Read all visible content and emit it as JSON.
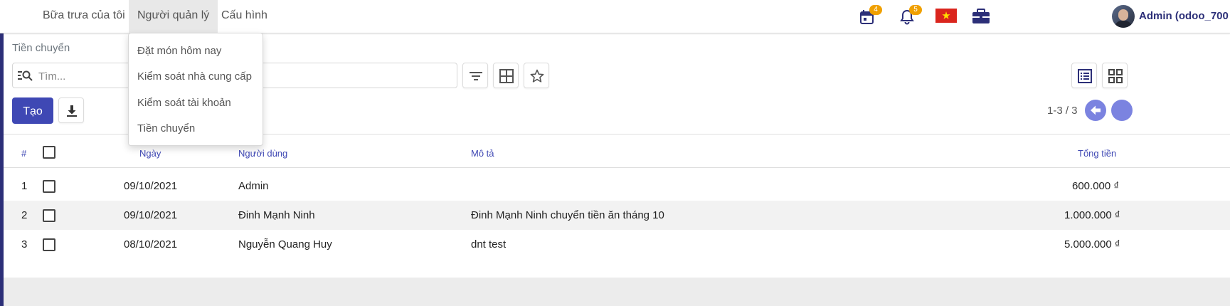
{
  "topbar": {
    "menu": [
      "Bữa trưa của tôi",
      "Người quản lý",
      "Cấu hình"
    ],
    "calendar_count": "4",
    "notification_count": "5",
    "user_name": "Admin (odoo_700"
  },
  "dropdown": {
    "items": [
      "Đặt món hôm nay",
      "Kiểm soát nhà cung cấp",
      "Kiểm soát tài khoản",
      "Tiền chuyển"
    ]
  },
  "page": {
    "breadcrumb": "Tiền chuyển",
    "search_placeholder": "Tìm...",
    "create_label": "Tạo",
    "pager": "1-3 / 3"
  },
  "table": {
    "headers": {
      "num": "#",
      "date": "Ngày",
      "user": "Người dùng",
      "description": "Mô tả",
      "total": "Tổng tiền"
    },
    "rows": [
      {
        "num": "1",
        "date": "09/10/2021",
        "user": "Admin",
        "description": "",
        "total": "600.000 ₫"
      },
      {
        "num": "2",
        "date": "09/10/2021",
        "user": "Đinh Mạnh Ninh",
        "description": "Đinh Mạnh Ninh chuyển tiền ăn tháng 10",
        "total": "1.000.000 ₫"
      },
      {
        "num": "3",
        "date": "08/10/2021",
        "user": "Nguyễn Quang Huy",
        "description": "dnt test",
        "total": "5.000.000 ₫"
      }
    ]
  },
  "colors": {
    "primary": "#3f48b4",
    "sidebar": "#2c2f78",
    "badge": "#f0a000",
    "header_text": "#3f48b4"
  },
  "icons": [
    "calendar-icon",
    "bell-icon",
    "vietnam-flag-icon",
    "briefcase-icon",
    "search-filter-icon",
    "filter-icon",
    "group-by-icon",
    "favorite-star-icon",
    "download-icon",
    "list-view-icon",
    "kanban-view-icon",
    "arrow-left-icon"
  ]
}
